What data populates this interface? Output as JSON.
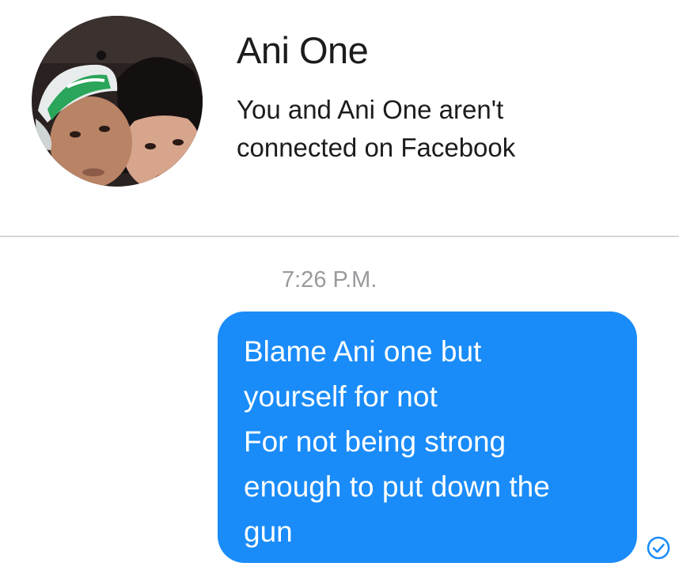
{
  "profile": {
    "name": "Ani One",
    "connection_status": "You and Ani One aren't connected on Facebook"
  },
  "conversation": {
    "timestamp": "7:26 P.M.",
    "messages": [
      {
        "sender": "self",
        "lines": [
          "Blame Ani one but",
          "yourself for not",
          "For not being strong",
          "enough to put down the",
          "gun"
        ],
        "status_icon": "sent-check-icon"
      }
    ]
  },
  "colors": {
    "bubble": "#1a8cf9",
    "bubble_text": "#ffffff",
    "timestamp": "#9a9a9e",
    "divider": "#d6d6d8"
  }
}
